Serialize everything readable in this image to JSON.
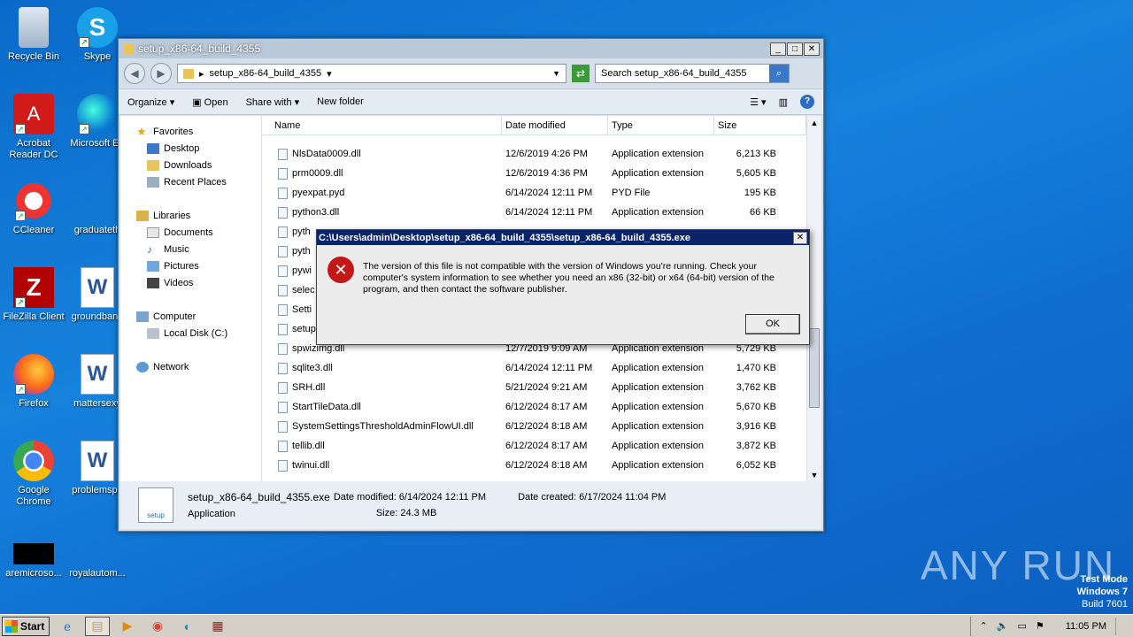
{
  "desktop": {
    "icons": [
      {
        "label": "Recycle Bin"
      },
      {
        "label": "Skype"
      },
      {
        "label": "Acrobat Reader DC"
      },
      {
        "label": "Microsoft Ed"
      },
      {
        "label": "CCleaner"
      },
      {
        "label": "graduateth"
      },
      {
        "label": "FileZilla Client"
      },
      {
        "label": "groundband"
      },
      {
        "label": "Firefox"
      },
      {
        "label": "mattersexy"
      },
      {
        "label": "Google Chrome"
      },
      {
        "label": "problemspe"
      },
      {
        "label": "aremicroso..."
      },
      {
        "label": "royalautom..."
      }
    ]
  },
  "explorer": {
    "title": "setup_x86-64_build_4355",
    "address": "setup_x86-64_build_4355",
    "search_placeholder": "Search setup_x86-64_build_4355",
    "toolbar": {
      "organize": "Organize",
      "open": "Open",
      "share_with": "Share with",
      "new_folder": "New folder"
    },
    "nav": {
      "favorites": "Favorites",
      "desktop": "Desktop",
      "downloads": "Downloads",
      "recent": "Recent Places",
      "libraries": "Libraries",
      "documents": "Documents",
      "music": "Music",
      "pictures": "Pictures",
      "videos": "Videos",
      "computer": "Computer",
      "local_disk": "Local Disk (C:)",
      "network": "Network"
    },
    "columns": {
      "name": "Name",
      "date": "Date modified",
      "type": "Type",
      "size": "Size"
    },
    "files": [
      {
        "name": "NlsData0009.dll",
        "date": "12/6/2019 4:26 PM",
        "type": "Application extension",
        "size": "6,213 KB"
      },
      {
        "name": "prm0009.dll",
        "date": "12/6/2019 4:36 PM",
        "type": "Application extension",
        "size": "5,605 KB"
      },
      {
        "name": "pyexpat.pyd",
        "date": "6/14/2024 12:11 PM",
        "type": "PYD File",
        "size": "195 KB"
      },
      {
        "name": "python3.dll",
        "date": "6/14/2024 12:11 PM",
        "type": "Application extension",
        "size": "66 KB"
      },
      {
        "name": "pyth",
        "date": "",
        "type": "",
        "size": ""
      },
      {
        "name": "pyth",
        "date": "",
        "type": "",
        "size": ""
      },
      {
        "name": "pywi",
        "date": "",
        "type": "",
        "size": ""
      },
      {
        "name": "selec",
        "date": "",
        "type": "",
        "size": ""
      },
      {
        "name": "Setti",
        "date": "",
        "type": "",
        "size": ""
      },
      {
        "name": "setup",
        "date": "",
        "type": "",
        "size": ""
      },
      {
        "name": "spwizimg.dll",
        "date": "12/7/2019 9:09 AM",
        "type": "Application extension",
        "size": "5,729 KB"
      },
      {
        "name": "sqlite3.dll",
        "date": "6/14/2024 12:11 PM",
        "type": "Application extension",
        "size": "1,470 KB"
      },
      {
        "name": "SRH.dll",
        "date": "5/21/2024 9:21 AM",
        "type": "Application extension",
        "size": "3,762 KB"
      },
      {
        "name": "StartTileData.dll",
        "date": "6/12/2024 8:17 AM",
        "type": "Application extension",
        "size": "5,670 KB"
      },
      {
        "name": "SystemSettingsThresholdAdminFlowUI.dll",
        "date": "6/12/2024 8:18 AM",
        "type": "Application extension",
        "size": "3,916 KB"
      },
      {
        "name": "tellib.dll",
        "date": "6/12/2024 8:17 AM",
        "type": "Application extension",
        "size": "3,872 KB"
      },
      {
        "name": "twinui.dll",
        "date": "6/12/2024 8:18 AM",
        "type": "Application extension",
        "size": "6,052 KB"
      }
    ],
    "status": {
      "filename": "setup_x86-64_build_4355.exe",
      "kind": "Application",
      "modified": "Date modified: 6/14/2024 12:11 PM",
      "size": "Size: 24.3 MB",
      "created": "Date created: 6/17/2024 11:04 PM"
    }
  },
  "dialog": {
    "title": "C:\\Users\\admin\\Desktop\\setup_x86-64_build_4355\\setup_x86-64_build_4355.exe",
    "message": "The version of this file is not compatible with the version of Windows you're running. Check your computer's system information to see whether you need an x86 (32-bit) or x64 (64-bit) version of the program, and then contact the software publisher.",
    "ok": "OK"
  },
  "watermark": {
    "brand": "ANY RUN",
    "test_mode": "Test Mode",
    "os": "Windows 7",
    "build": "Build 7601"
  },
  "taskbar": {
    "start": "Start",
    "clock": "11:05 PM"
  }
}
